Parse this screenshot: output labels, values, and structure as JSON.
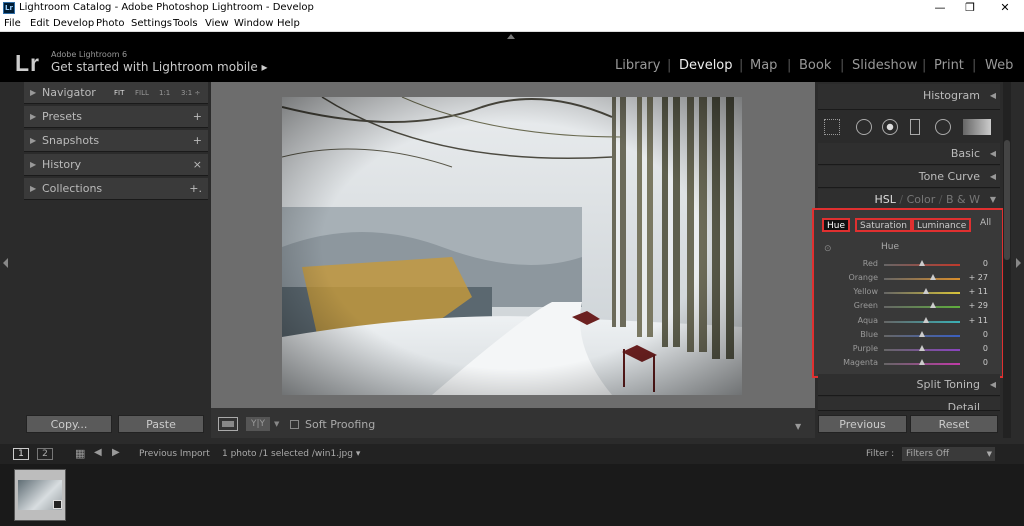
{
  "titlebar": {
    "title": "Lightroom Catalog - Adobe Photoshop Lightroom - Develop",
    "icon": "Lr"
  },
  "menu": [
    "File",
    "Edit",
    "Develop",
    "Photo",
    "Settings",
    "Tools",
    "View",
    "Window",
    "Help"
  ],
  "brand": {
    "logo": "Lr",
    "version": "Adobe Lightroom 6",
    "mobile": "Get started with Lightroom mobile ▸"
  },
  "modules": [
    "Library",
    "Develop",
    "Map",
    "Book",
    "Slideshow",
    "Print",
    "Web"
  ],
  "active_module": "Develop",
  "left_panels": [
    {
      "label": "Navigator",
      "action": ""
    },
    {
      "label": "Presets",
      "action": "+"
    },
    {
      "label": "Snapshots",
      "action": "+"
    },
    {
      "label": "History",
      "action": "×"
    },
    {
      "label": "Collections",
      "action": "+."
    }
  ],
  "navigator_zoom": [
    "FIT",
    "FILL",
    "1:1",
    "3:1 ÷"
  ],
  "right_panels": {
    "histogram": "Histogram",
    "basic": "Basic",
    "tone_curve": "Tone Curve",
    "hsl": "HSL",
    "color": "Color",
    "bw": "B & W",
    "split_toning": "Split Toning",
    "detail": "Detail"
  },
  "hsl_tabs": [
    "Hue",
    "Saturation",
    "Luminance",
    "All"
  ],
  "hsl_section": "Hue",
  "hue_sliders": [
    {
      "label": "Red",
      "value": "0",
      "pos": 0.5,
      "color": "#c0392b"
    },
    {
      "label": "Orange",
      "value": "+ 27",
      "pos": 0.64,
      "color": "#d98e2c"
    },
    {
      "label": "Yellow",
      "value": "+ 11",
      "pos": 0.55,
      "color": "#d8c43a"
    },
    {
      "label": "Green",
      "value": "+ 29",
      "pos": 0.64,
      "color": "#5fae3c"
    },
    {
      "label": "Aqua",
      "value": "+ 11",
      "pos": 0.55,
      "color": "#3ab0b5"
    },
    {
      "label": "Blue",
      "value": "0",
      "pos": 0.5,
      "color": "#3a5fc0"
    },
    {
      "label": "Purple",
      "value": "0",
      "pos": 0.5,
      "color": "#8a44c0"
    },
    {
      "label": "Magenta",
      "value": "0",
      "pos": 0.5,
      "color": "#c03aa8"
    }
  ],
  "buttons": {
    "copy": "Copy...",
    "paste": "Paste",
    "previous": "Previous",
    "reset": "Reset"
  },
  "toolbar": {
    "soft_proofing": "Soft Proofing",
    "compare": "Y|Y"
  },
  "filmstrip": {
    "page1": "1",
    "page2": "2",
    "source": "Previous Import",
    "info": "1 photo /1 selected /win1.jpg ▾",
    "filter_label": "Filter :",
    "filter_value": "Filters Off"
  }
}
